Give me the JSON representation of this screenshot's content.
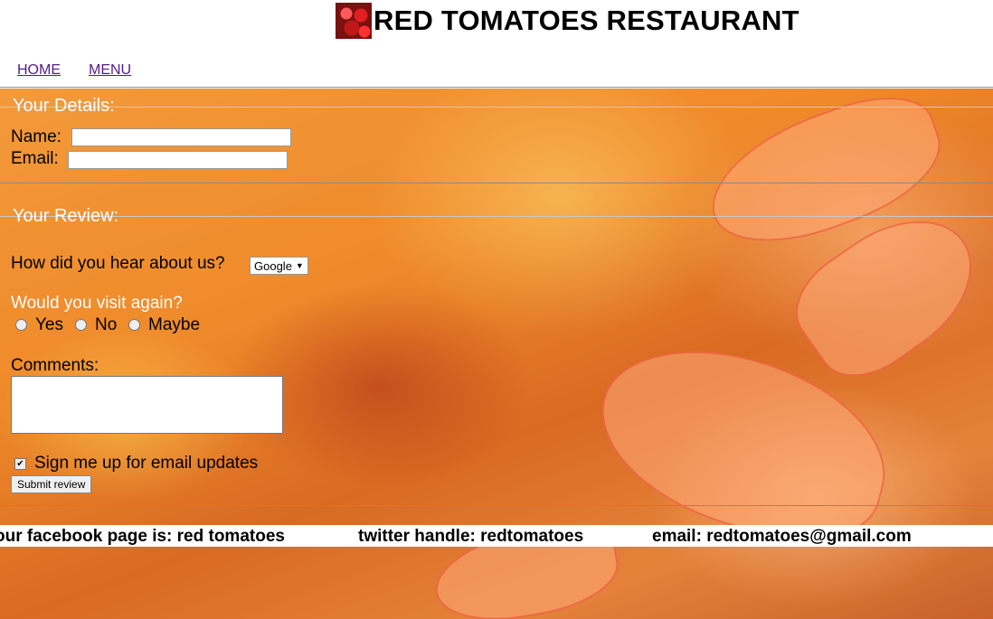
{
  "header": {
    "title": "RED TOMATOES RESTAURANT",
    "logo_icon": "tomatoes-logo-icon"
  },
  "nav": {
    "items": [
      {
        "label": "HOME"
      },
      {
        "label": "MENU"
      }
    ]
  },
  "details": {
    "legend": "Your Details:",
    "name_label": "Name:",
    "name_value": "",
    "email_label": "Email:",
    "email_value": ""
  },
  "review": {
    "legend": "Your Review:",
    "hear_label": "How did you hear about us?",
    "hear_selected": "Google",
    "visit_label": "Would you visit again?",
    "visit_options": [
      "Yes",
      "No",
      "Maybe"
    ],
    "comments_label": "Comments:",
    "comments_value": "",
    "signup_label": "Sign me up for email updates",
    "signup_checked": true,
    "submit_label": "Submit review"
  },
  "footer": {
    "facebook": "our facebook page is: red tomatoes",
    "twitter": "twitter handle: redtomatoes",
    "email": "email: redtomatoes@gmail.com"
  },
  "colors": {
    "link": "#551a8b",
    "background_accent": "#ef8a2a"
  }
}
